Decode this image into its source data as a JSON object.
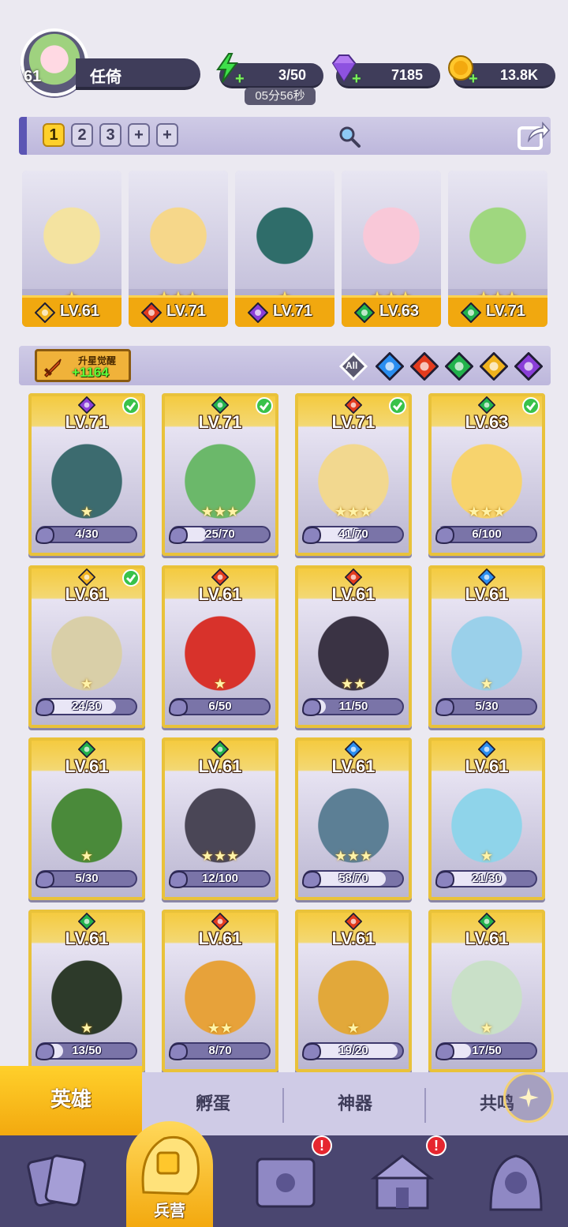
{
  "player": {
    "level": "61",
    "name": "任倚"
  },
  "resources": {
    "energy": "3/50",
    "energy_timer": "05分56秒",
    "gems": "7185",
    "gold": "13.8K"
  },
  "team_tabs": [
    "1",
    "2",
    "3",
    "+",
    "+"
  ],
  "active_team_tab": "1",
  "team": [
    {
      "level": "LV.61",
      "element": "light",
      "stars": 1
    },
    {
      "level": "LV.71",
      "element": "fire",
      "stars": 3
    },
    {
      "level": "LV.71",
      "element": "dark",
      "stars": 1
    },
    {
      "level": "LV.63",
      "element": "wind",
      "stars": 3
    },
    {
      "level": "LV.71",
      "element": "wind",
      "stars": 3
    }
  ],
  "upstar": {
    "label": "升星觉醒",
    "value": "+1164"
  },
  "filters": {
    "all_label": "All",
    "elements": [
      "water",
      "fire",
      "wind",
      "light",
      "dark"
    ]
  },
  "element_colors": {
    "fire": "#e33b1e",
    "water": "#2a8ef0",
    "wind": "#22b24c",
    "light": "#f0b21d",
    "dark": "#8a3fd8"
  },
  "heroes": [
    {
      "level": "LV.71",
      "element": "dark",
      "checked": true,
      "stars": 1,
      "shards": "4/30",
      "progress": 0.13
    },
    {
      "level": "LV.71",
      "element": "wind",
      "checked": true,
      "stars": 3,
      "shards": "25/70",
      "progress": 0.36
    },
    {
      "level": "LV.71",
      "element": "fire",
      "checked": true,
      "stars": 3,
      "shards": "41/70",
      "progress": 0.59
    },
    {
      "level": "LV.63",
      "element": "wind",
      "checked": true,
      "stars": 3,
      "shards": "6/100",
      "progress": 0.06
    },
    {
      "level": "LV.61",
      "element": "light",
      "checked": true,
      "stars": 1,
      "shards": "24/30",
      "progress": 0.8
    },
    {
      "level": "LV.61",
      "element": "fire",
      "checked": false,
      "stars": 1,
      "shards": "6/50",
      "progress": 0.12
    },
    {
      "level": "LV.61",
      "element": "fire",
      "checked": false,
      "stars": 2,
      "shards": "11/50",
      "progress": 0.22
    },
    {
      "level": "LV.61",
      "element": "water",
      "checked": false,
      "stars": 1,
      "shards": "5/30",
      "progress": 0.17
    },
    {
      "level": "LV.61",
      "element": "wind",
      "checked": false,
      "stars": 1,
      "shards": "5/30",
      "progress": 0.17
    },
    {
      "level": "LV.61",
      "element": "wind",
      "checked": false,
      "stars": 3,
      "shards": "12/100",
      "progress": 0.12
    },
    {
      "level": "LV.61",
      "element": "water",
      "checked": false,
      "stars": 3,
      "shards": "58/70",
      "progress": 0.83
    },
    {
      "level": "LV.61",
      "element": "water",
      "checked": false,
      "stars": 1,
      "shards": "21/30",
      "progress": 0.7
    },
    {
      "level": "LV.61",
      "element": "wind",
      "checked": false,
      "stars": 1,
      "shards": "13/50",
      "progress": 0.26
    },
    {
      "level": "LV.61",
      "element": "fire",
      "checked": false,
      "stars": 2,
      "shards": "8/70",
      "progress": 0.11
    },
    {
      "level": "LV.61",
      "element": "fire",
      "checked": false,
      "stars": 1,
      "shards": "19/20",
      "progress": 0.95
    },
    {
      "level": "LV.61",
      "element": "wind",
      "checked": false,
      "stars": 1,
      "shards": "17/50",
      "progress": 0.34
    }
  ],
  "subtabs": [
    "英雄",
    "孵蛋",
    "神器",
    "共鸣"
  ],
  "nav": {
    "active_label": "兵营",
    "badges": [
      "!",
      "!"
    ]
  }
}
